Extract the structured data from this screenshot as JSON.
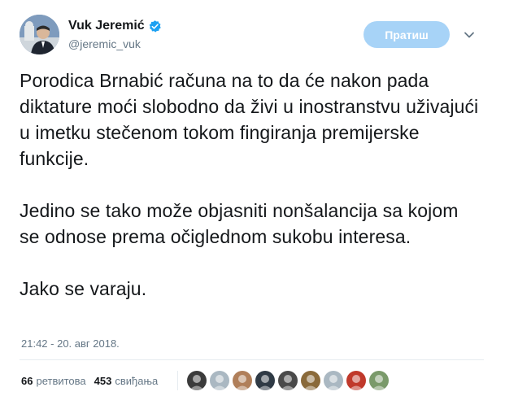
{
  "author": {
    "name": "Vuk Jeremić",
    "handle": "@jeremic_vuk",
    "verified": true
  },
  "follow_button": {
    "label": "Пратиш"
  },
  "tweet": {
    "paragraphs": [
      "Porodica Brnabić računa na to da će nakon pada diktature moći slobodno da živi u inostranstvu uživajući u imetku stečenom tokom fingiranja premijerske funkcije.",
      "Jedino se tako može objasniti nonšalancija sa kojom se odnose prema očiglednom sukobu interesa.",
      "Jako se varaju."
    ],
    "timestamp": "21:42 - 20. авг 2018."
  },
  "stats": {
    "retweets_count": "66",
    "retweets_label": "ретвитова",
    "likes_count": "453",
    "likes_label": "свиђања"
  },
  "likers": [
    {
      "name": "liker-avatar-1",
      "color": "#3b3b3b"
    },
    {
      "name": "liker-avatar-2",
      "color": "#aab8c2"
    },
    {
      "name": "liker-avatar-3",
      "color": "#b07f5a"
    },
    {
      "name": "liker-avatar-4",
      "color": "#2f3a45"
    },
    {
      "name": "liker-avatar-5",
      "color": "#4a4a4a"
    },
    {
      "name": "liker-avatar-6",
      "color": "#8a6a3a"
    },
    {
      "name": "liker-avatar-7",
      "color": "#aab8c2"
    },
    {
      "name": "liker-avatar-8",
      "color": "#c0392b"
    },
    {
      "name": "liker-avatar-9",
      "color": "#7a9a6a"
    }
  ],
  "colors": {
    "follow_button_bg": "#a7d3f7",
    "verified_badge": "#1da1f2",
    "secondary_text": "#657786"
  }
}
